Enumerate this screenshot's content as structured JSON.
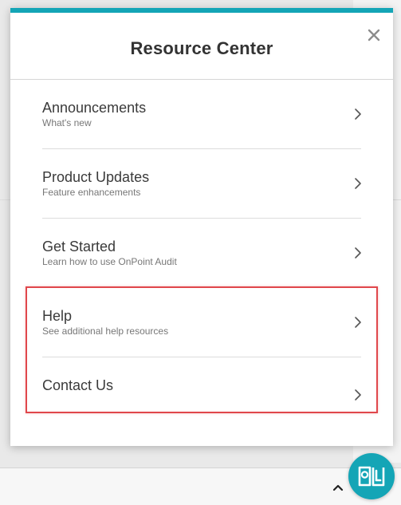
{
  "panel": {
    "title": "Resource Center",
    "close_icon": "close-icon",
    "accent_color": "#14a5b6"
  },
  "items": [
    {
      "label": "Announcements",
      "sub": "What's new"
    },
    {
      "label": "Product Updates",
      "sub": "Feature enhancements"
    },
    {
      "label": "Get Started",
      "sub": "Learn how to use OnPoint Audit"
    },
    {
      "label": "Help",
      "sub": "See additional help resources"
    },
    {
      "label": "Contact Us",
      "sub": ""
    }
  ],
  "highlight_color": "#e0474c",
  "fab_icon": "resource-book-icon"
}
